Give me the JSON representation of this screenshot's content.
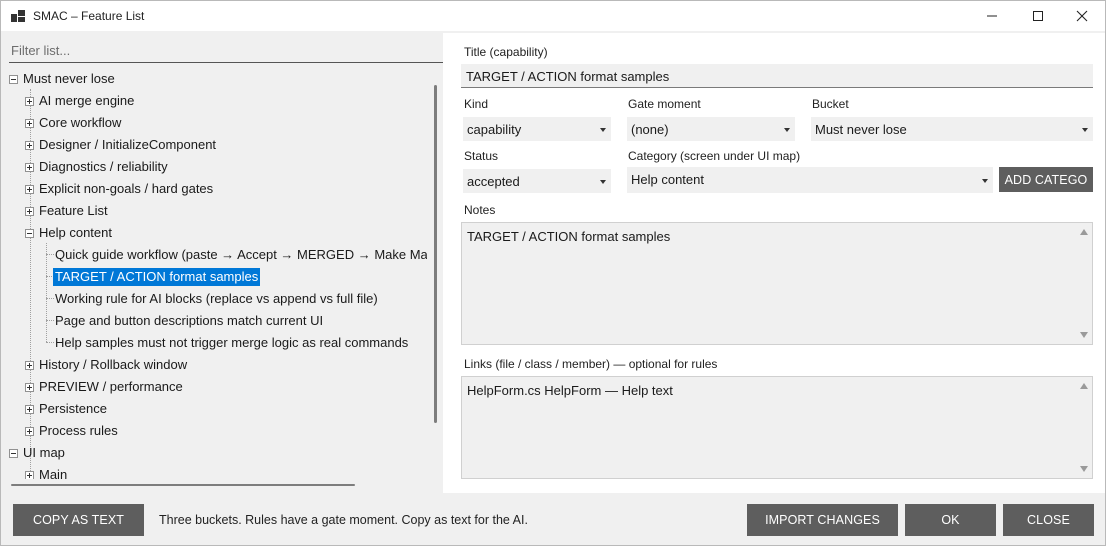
{
  "window": {
    "title": "SMAC – Feature List"
  },
  "filter": {
    "placeholder": "Filter list..."
  },
  "tree": {
    "root1": "Must never lose",
    "root1_items": [
      "AI merge engine",
      "Core workflow",
      "Designer / InitializeComponent",
      "Diagnostics / reliability",
      "Explicit non-goals / hard gates",
      "Feature List",
      "Help content"
    ],
    "help_children": [
      "Quick guide workflow (paste → Accept → MERGED → Make Mas",
      "TARGET / ACTION format samples",
      "Working rule for AI blocks (replace vs append vs full file)",
      "Page and button descriptions match current UI",
      "Help samples must not trigger merge logic as real commands"
    ],
    "root1_items_after": [
      "History / Rollback window",
      "PREVIEW / performance",
      "Persistence",
      "Process rules"
    ],
    "root2": "UI map",
    "root2_items": [
      "Main"
    ]
  },
  "form": {
    "title_label": "Title (capability)",
    "title_value": "TARGET / ACTION format samples",
    "kind_label": "Kind",
    "kind_value": "capability",
    "gate_label": "Gate moment",
    "gate_value": "(none)",
    "bucket_label": "Bucket",
    "bucket_value": "Must never lose",
    "status_label": "Status",
    "status_value": "accepted",
    "category_label": "Category (screen under UI map)",
    "category_value": "Help content",
    "add_category_button": "ADD CATEGO",
    "notes_label": "Notes",
    "notes_value": "TARGET / ACTION format samples",
    "links_label": "Links (file / class / member) — optional for rules",
    "links_value": "HelpForm.cs  HelpForm — Help text"
  },
  "bottom": {
    "copy_button": "COPY AS TEXT",
    "status": "Three buckets. Rules have a gate moment. Copy as text for the AI.",
    "import_button": "IMPORT CHANGES",
    "ok_button": "OK",
    "close_button": "CLOSE"
  },
  "colors": {
    "selection": "#0078d7",
    "button": "#5e5e5e"
  }
}
